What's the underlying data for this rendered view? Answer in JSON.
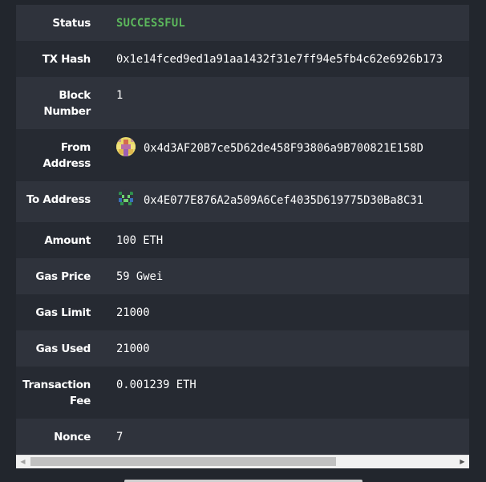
{
  "transaction": {
    "rows": [
      {
        "label": "Status",
        "value": "SUCCESSFUL"
      },
      {
        "label": "TX Hash",
        "value": "0x1e14fced9ed1a91aa1432f31e7ff94e5fb4c62e6926b173"
      },
      {
        "label": "Block Number",
        "value": "1"
      },
      {
        "label": "From Address",
        "value": "0x4d3AF20B7ce5D62de458F93806a9B700821E158D",
        "icon": "identicon-avatar-yellow-purple"
      },
      {
        "label": "To Address",
        "value": "0x4E077E876A2a509A6Cef4035D619775D30Ba8C31",
        "icon": "identicon-avatar-green-blue"
      },
      {
        "label": "Amount",
        "value": "100 ETH"
      },
      {
        "label": "Gas Price",
        "value": "59 Gwei"
      },
      {
        "label": "Gas Limit",
        "value": "21000"
      },
      {
        "label": "Gas Used",
        "value": "21000"
      },
      {
        "label": "Transaction Fee",
        "value": "0.001239 ETH"
      },
      {
        "label": "Nonce",
        "value": "7"
      }
    ]
  },
  "colors": {
    "background": "#22262d",
    "row_odd": "#2f333c",
    "row_even": "#262a32",
    "success": "#5cb85c",
    "text": "#ffffff"
  },
  "scrollbar": {
    "left_arrow_icon": "scroll-left-icon",
    "right_arrow_icon": "scroll-right-icon",
    "thumb_fraction": 0.72
  }
}
